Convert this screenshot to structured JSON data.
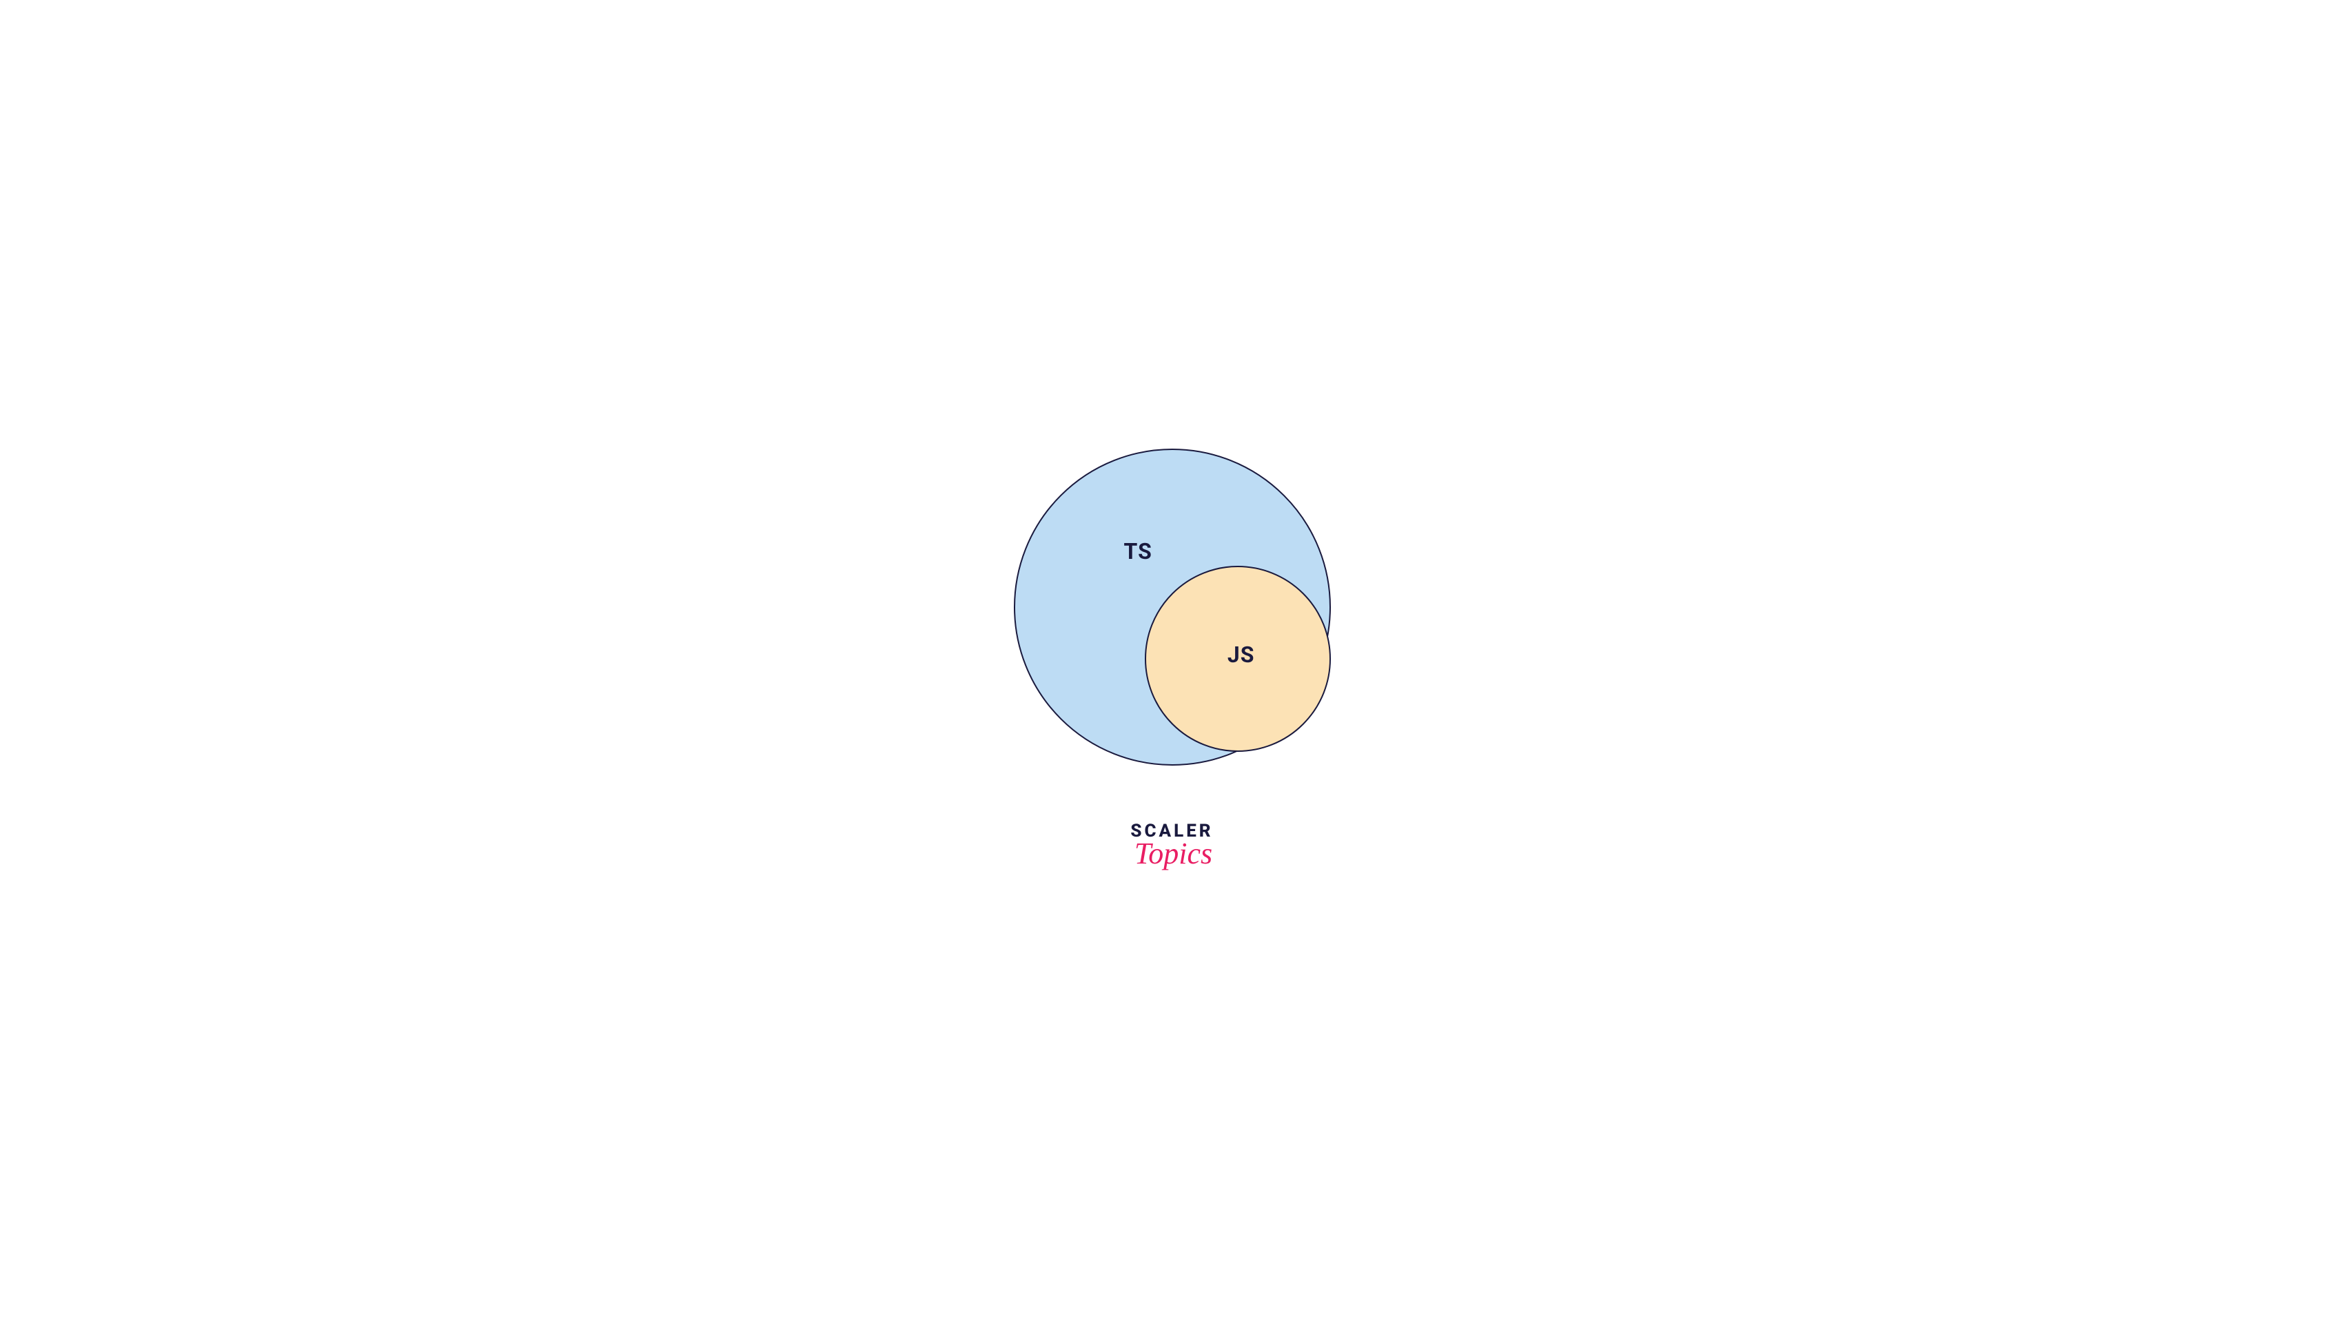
{
  "diagram": {
    "outer_label": "TS",
    "inner_label": "JS",
    "outer_color": "#bddcf4",
    "inner_color": "#fce2b5",
    "border_color": "#1a1a3e"
  },
  "logo": {
    "line1": "SCALER",
    "line2": "Topics"
  }
}
